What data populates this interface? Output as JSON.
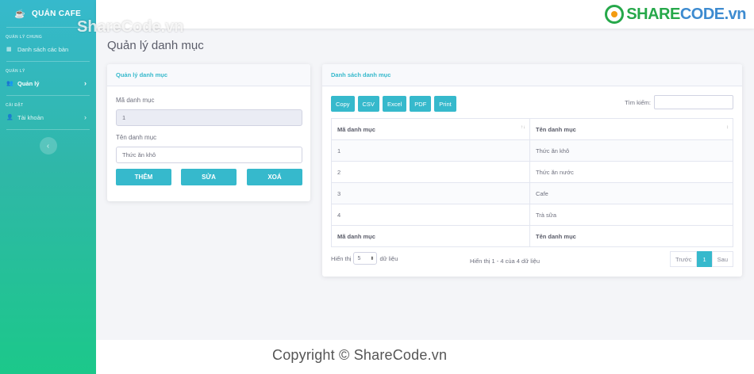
{
  "sidebar": {
    "brand": "QUÁN CAFE",
    "sections": [
      {
        "heading": "QUẢN LÝ CHUNG",
        "item": "Danh sách các bàn"
      },
      {
        "heading": "QUẢN LÝ",
        "item": "Quản lý"
      },
      {
        "heading": "CÀI ĐẶT",
        "item": "Tài khoản"
      }
    ]
  },
  "page_title": "Quản lý danh mục",
  "form": {
    "title": "Quản lý danh mục",
    "id_label": "Mã danh mục",
    "id_value": "1",
    "name_label": "Tên danh mục",
    "name_value": "Thức ăn khô",
    "buttons": {
      "add": "THÊM",
      "edit": "SỬA",
      "delete": "XOÁ"
    }
  },
  "list": {
    "title": "Danh sách danh mục",
    "export_buttons": [
      "Copy",
      "CSV",
      "Excel",
      "PDF",
      "Print"
    ],
    "search_label": "Tìm kiếm:",
    "columns": [
      "Mã danh mục",
      "Tên danh mục"
    ],
    "rows": [
      [
        "1",
        "Thức ăn khô"
      ],
      [
        "2",
        "Thức ăn nước"
      ],
      [
        "3",
        "Cafe"
      ],
      [
        "4",
        "Trà sữa"
      ]
    ],
    "length_prefix": "Hiển thị",
    "length_value": "5",
    "length_suffix": "dữ liệu",
    "info": "Hiển thị 1 - 4 của 4 dữ liệu",
    "pager": {
      "prev": "Trước",
      "current": "1",
      "next": "Sau"
    }
  },
  "watermark": {
    "top": "ShareCode.vn",
    "logo_a": "SHARE",
    "logo_b": "CODE.vn",
    "copyright": "Copyright © ShareCode.vn"
  }
}
